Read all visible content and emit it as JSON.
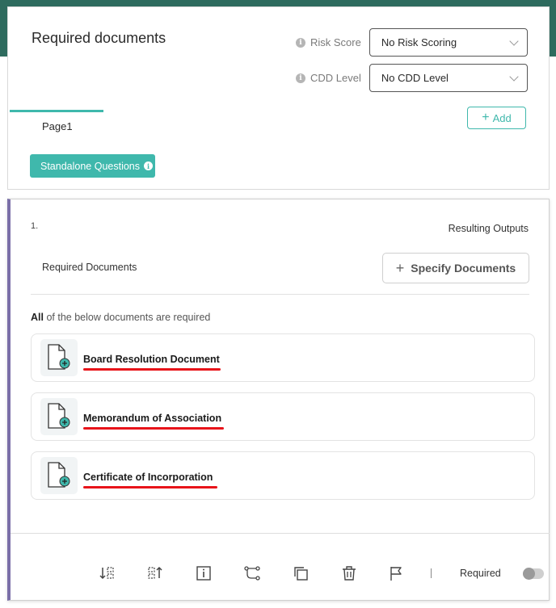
{
  "header": {
    "title": "Required documents",
    "risk_score_label": "Risk Score",
    "risk_score_value": "No Risk Scoring",
    "cdd_level_label": "CDD Level",
    "cdd_level_value": "No CDD Level",
    "page_tab": "Page1",
    "add_label": "Add",
    "standalone_label": "Standalone Questions"
  },
  "question": {
    "number": "1.",
    "resulting_outputs": "Resulting Outputs",
    "label": "Required Documents",
    "specify_label": "Specify Documents",
    "requirement_strong": "All",
    "requirement_rest": " of the below documents are required",
    "documents": [
      {
        "title": "Board Resolution Document"
      },
      {
        "title": "Memorandum of Association"
      },
      {
        "title": "Certificate of Incorporation"
      }
    ]
  },
  "footer": {
    "required_label": "Required",
    "required_on": false
  },
  "colors": {
    "accent": "#3fb8ac",
    "band": "#2e6b5e",
    "underline": "#e8141a",
    "left_border": "#7a6fa8"
  }
}
